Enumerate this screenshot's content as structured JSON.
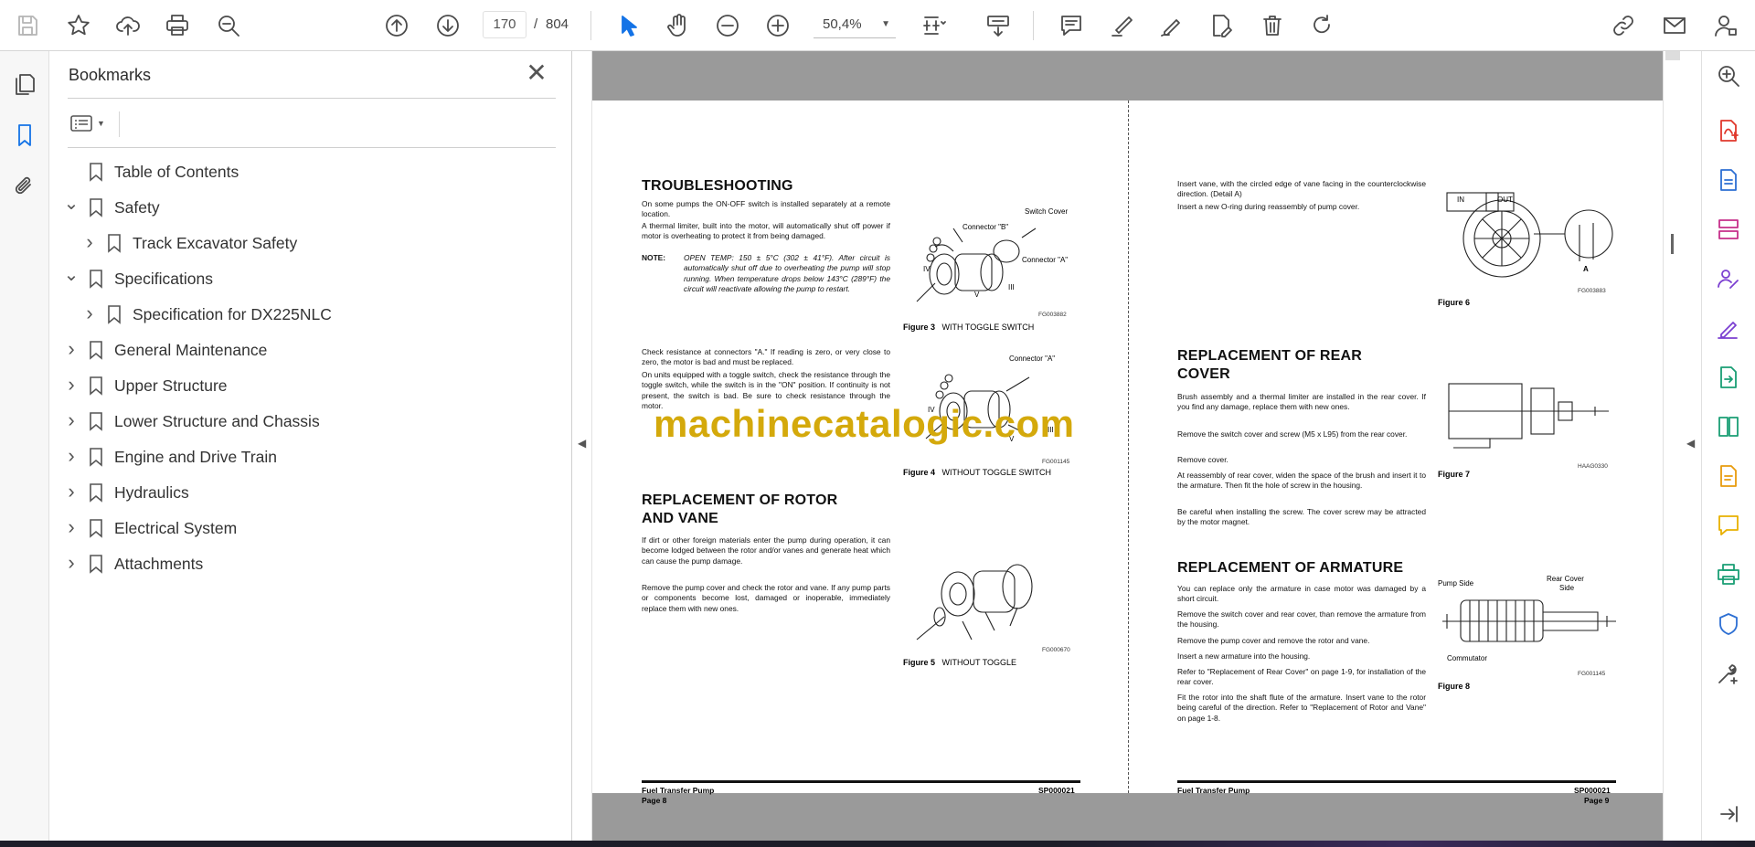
{
  "toolbar": {
    "page_current": "170",
    "page_separator": "/",
    "page_total": "804",
    "zoom": "50,4%"
  },
  "bookmarks": {
    "title": "Bookmarks",
    "items": [
      {
        "label": "Table of Contents",
        "expand": "none",
        "level": 0
      },
      {
        "label": "Safety",
        "expand": "expanded",
        "level": 0
      },
      {
        "label": "Track Excavator Safety",
        "expand": "collapsed",
        "level": 1
      },
      {
        "label": "Specifications",
        "expand": "expanded",
        "level": 0
      },
      {
        "label": "Specification for DX225NLC",
        "expand": "collapsed",
        "level": 1
      },
      {
        "label": "General Maintenance",
        "expand": "collapsed",
        "level": 0
      },
      {
        "label": "Upper Structure",
        "expand": "collapsed",
        "level": 0
      },
      {
        "label": "Lower Structure and Chassis",
        "expand": "collapsed",
        "level": 0
      },
      {
        "label": "Engine and Drive Train",
        "expand": "collapsed",
        "level": 0
      },
      {
        "label": "Hydraulics",
        "expand": "collapsed",
        "level": 0
      },
      {
        "label": "Electrical System",
        "expand": "collapsed",
        "level": 0
      },
      {
        "label": "Attachments",
        "expand": "collapsed",
        "level": 0
      }
    ]
  },
  "doc": {
    "watermark": "machinecatalogic.com",
    "left": {
      "h_troubleshooting": "TROUBLESHOOTING",
      "p1": "On some pumps the ON-OFF switch is installed separately at a remote location.",
      "p2": "A thermal limiter, built into the motor, will automatically shut off power if motor is overheating to protect it from being damaged.",
      "note_label": "NOTE:",
      "note_text": "OPEN TEMP: 150 ± 5°C (302 ± 41°F). After circuit is automatically shut off due to overheating the pump will stop running. When temperature drops below 143°C (289°F) the circuit will reactivate allowing the pump to restart.",
      "p3": "Check resistance at connectors \"A.\" If reading is zero, or very close to zero, the motor is bad and must be replaced.",
      "p4": "On units equipped with a toggle switch, check the resistance through the toggle switch, while the switch is in the \"ON\" position. If continuity is not present, the switch is bad. Be sure to check resistance through the motor.",
      "h_rotor_1": "REPLACEMENT OF ROTOR",
      "h_rotor_2": "AND VANE",
      "p5": "If dirt or other foreign materials enter the pump during operation, it can become lodged between the rotor and/or vanes and generate heat which can cause the pump damage.",
      "p6": "Remove the pump cover and check the rotor and vane. If any pump parts or components become lost, damaged or inoperable, immediately replace them with new ones.",
      "fig3_num": "Figure 3",
      "fig3_cap": "WITH TOGGLE SWITCH",
      "fig3_code": "FG003882",
      "fig3_l1": "Switch Cover",
      "fig3_l2": "Connector \"B\"",
      "fig3_l3": "Connector \"A\"",
      "fig3_l4": "IV",
      "fig3_l5": "V",
      "fig3_l6": "III",
      "fig4_num": "Figure 4",
      "fig4_cap": "WITHOUT TOGGLE SWITCH",
      "fig4_code": "FG001145",
      "fig4_l1": "Connector \"A\"",
      "fig4_l2": "IV",
      "fig4_l3": "V",
      "fig4_l4": "III",
      "fig5_num": "Figure 5",
      "fig5_cap": "WITHOUT TOGGLE",
      "fig5_code": "FG000670",
      "foot_left": "Fuel Transfer Pump",
      "foot_page": "Page 8",
      "foot_code": "SP000021"
    },
    "right": {
      "p1": "Insert vane, with the circled edge of vane facing in the counterclockwise direction. (Detail A)",
      "p2": "Insert a new O-ring during reassembly of pump cover.",
      "h_rear_1": "REPLACEMENT OF REAR",
      "h_rear_2": "COVER",
      "p3": "Brush assembly and a thermal limiter are installed in the rear cover. If you find any damage, replace them with new ones.",
      "p4": "Remove the switch cover and screw (M5 x L95) from the rear cover.",
      "p5": "Remove cover.",
      "p6": "At reassembly of rear cover, widen the space of the brush and insert it to the armature. Then fit the hole of screw in the housing.",
      "p7": "Be careful when installing the screw. The cover screw may be attracted by the motor magnet.",
      "h_arm": "REPLACEMENT OF ARMATURE",
      "p8": "You can replace only the armature in case motor was damaged by a short circuit.",
      "p9": "Remove the switch cover and rear cover, than remove the armature from the housing.",
      "p10": "Remove the pump cover and remove the rotor and vane.",
      "p11": "Insert a new armature into the housing.",
      "p12": "Refer to \"Replacement of Rear Cover\" on page 1-9, for installation of the rear cover.",
      "p13": "Fit the rotor into the shaft flute of the armature. Insert vane to the rotor being careful of the direction. Refer to \"Replacement of Rotor and Vane\" on page 1-8.",
      "fig6_num": "Figure 6",
      "fig6_code": "FG003883",
      "fig6_in": "IN",
      "fig6_out": "OUT",
      "fig6_a": "A",
      "fig7_num": "Figure 7",
      "fig7_code": "HAAG0330",
      "fig8_num": "Figure 8",
      "fig8_code": "FG001145",
      "fig8_l1": "Pump Side",
      "fig8_l2": "Rear Cover",
      "fig8_l3": "Side",
      "fig8_l4": "Commutator",
      "foot_left": "Fuel Transfer Pump",
      "foot_page": "Page 9",
      "foot_code": "SP000021"
    }
  }
}
